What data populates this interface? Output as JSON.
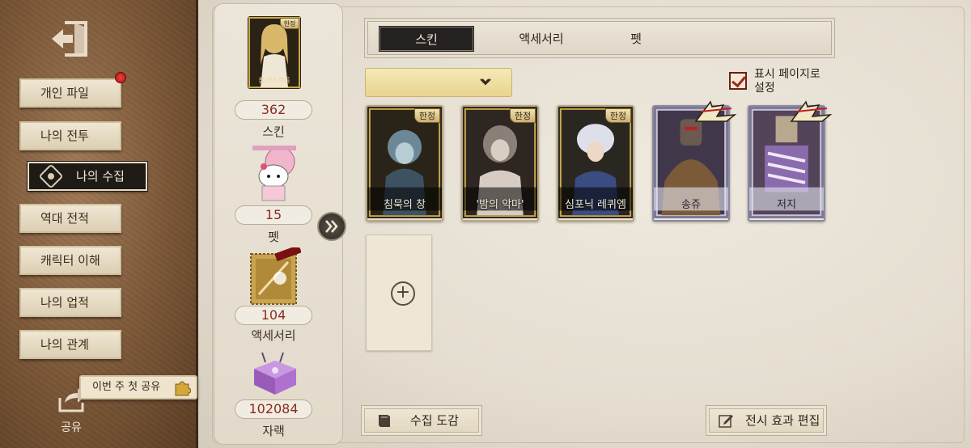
{
  "sidebar": {
    "items": [
      {
        "label": "개인 파일",
        "has_notification": true
      },
      {
        "label": "나의 전투"
      },
      {
        "label": "나의 수집",
        "active": true
      },
      {
        "label": "역대 전적"
      },
      {
        "label": "캐릭터 이해"
      },
      {
        "label": "나의 업적"
      },
      {
        "label": "나의 관계"
      }
    ],
    "share_banner": "이번 주 첫 공유",
    "share_label": "공유"
  },
  "summary": {
    "skin": {
      "count": "362",
      "label": "스킨",
      "badge": "한정",
      "caption": "참관의 여름"
    },
    "pet": {
      "count": "15",
      "label": "펫"
    },
    "accessory": {
      "count": "104",
      "label": "액세서리"
    },
    "charm": {
      "count": "102084",
      "label": "자랙"
    }
  },
  "tabs": [
    {
      "label": "스킨",
      "active": true
    },
    {
      "label": "액세서리"
    },
    {
      "label": "펫"
    }
  ],
  "display_page": {
    "label_line1": "표시 페이지로",
    "label_line2": "설정",
    "checked": true
  },
  "cards": [
    {
      "name": "침묵의 창",
      "badge": "한정"
    },
    {
      "name": "'밤의 악마'",
      "badge": "한정"
    },
    {
      "name": "심포닉 레퀴엠",
      "badge": "한정"
    },
    {
      "name": "송쥬",
      "event": true
    },
    {
      "name": "저지",
      "event": true
    }
  ],
  "buttons": {
    "codex": "수집 도감",
    "edit_display": "전시 효과 편집"
  },
  "colors": {
    "accent_red": "#8c2a1f",
    "active_tab": "#242120",
    "dropdown_gold": "#e8d48e"
  }
}
